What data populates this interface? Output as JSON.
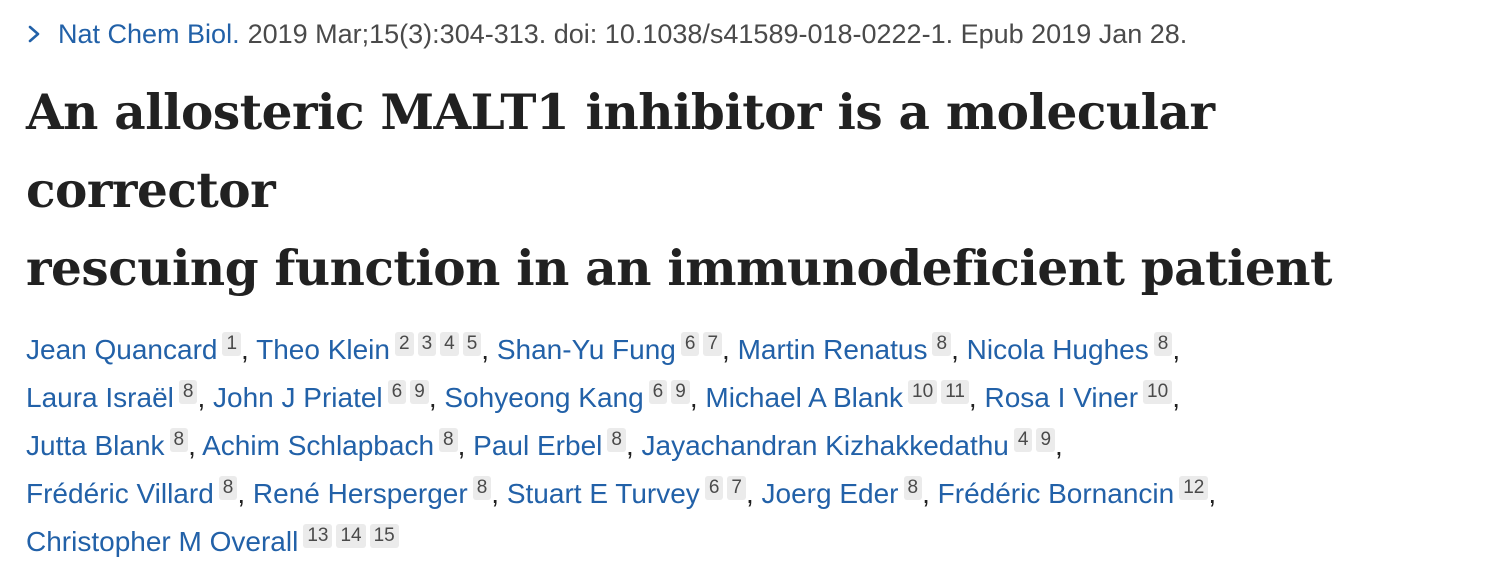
{
  "citation": {
    "journal": "Nat Chem Biol.",
    "details": "2019 Mar;15(3):304-313. doi: 10.1038/s41589-018-0222-1. Epub 2019 Jan 28."
  },
  "title": {
    "line1": "An allosteric MALT1 inhibitor is a molecular corrector",
    "line2": "rescuing function in an immunodeficient patient"
  },
  "authors": [
    {
      "name": "Jean Quancard",
      "affs": [
        "1"
      ]
    },
    {
      "name": "Theo Klein",
      "affs": [
        "2",
        "3",
        "4",
        "5"
      ]
    },
    {
      "name": "Shan-Yu Fung",
      "affs": [
        "6",
        "7"
      ]
    },
    {
      "name": "Martin Renatus",
      "affs": [
        "8"
      ]
    },
    {
      "name": "Nicola Hughes",
      "affs": [
        "8"
      ]
    },
    {
      "name": "Laura Israël",
      "affs": [
        "8"
      ]
    },
    {
      "name": "John J Priatel",
      "affs": [
        "6",
        "9"
      ]
    },
    {
      "name": "Sohyeong Kang",
      "affs": [
        "6",
        "9"
      ]
    },
    {
      "name": "Michael A Blank",
      "affs": [
        "10",
        "11"
      ]
    },
    {
      "name": "Rosa I Viner",
      "affs": [
        "10"
      ]
    },
    {
      "name": "Jutta Blank",
      "affs": [
        "8"
      ]
    },
    {
      "name": "Achim Schlapbach",
      "affs": [
        "8"
      ]
    },
    {
      "name": "Paul Erbel",
      "affs": [
        "8"
      ]
    },
    {
      "name": "Jayachandran Kizhakkedathu",
      "affs": [
        "4",
        "9"
      ]
    },
    {
      "name": "Frédéric Villard",
      "affs": [
        "8"
      ]
    },
    {
      "name": "René Hersperger",
      "affs": [
        "8"
      ]
    },
    {
      "name": "Stuart E Turvey",
      "affs": [
        "6",
        "7"
      ]
    },
    {
      "name": "Joerg Eder",
      "affs": [
        "8"
      ]
    },
    {
      "name": "Frédéric Bornancin",
      "affs": [
        "12"
      ]
    },
    {
      "name": "Christopher M Overall",
      "affs": [
        "13",
        "14",
        "15"
      ]
    }
  ],
  "colors": {
    "link": "#2261a8",
    "text": "#212121",
    "badge_bg": "#ebebeb"
  },
  "icons": {
    "journal_toggle": "chevron-right-icon"
  }
}
